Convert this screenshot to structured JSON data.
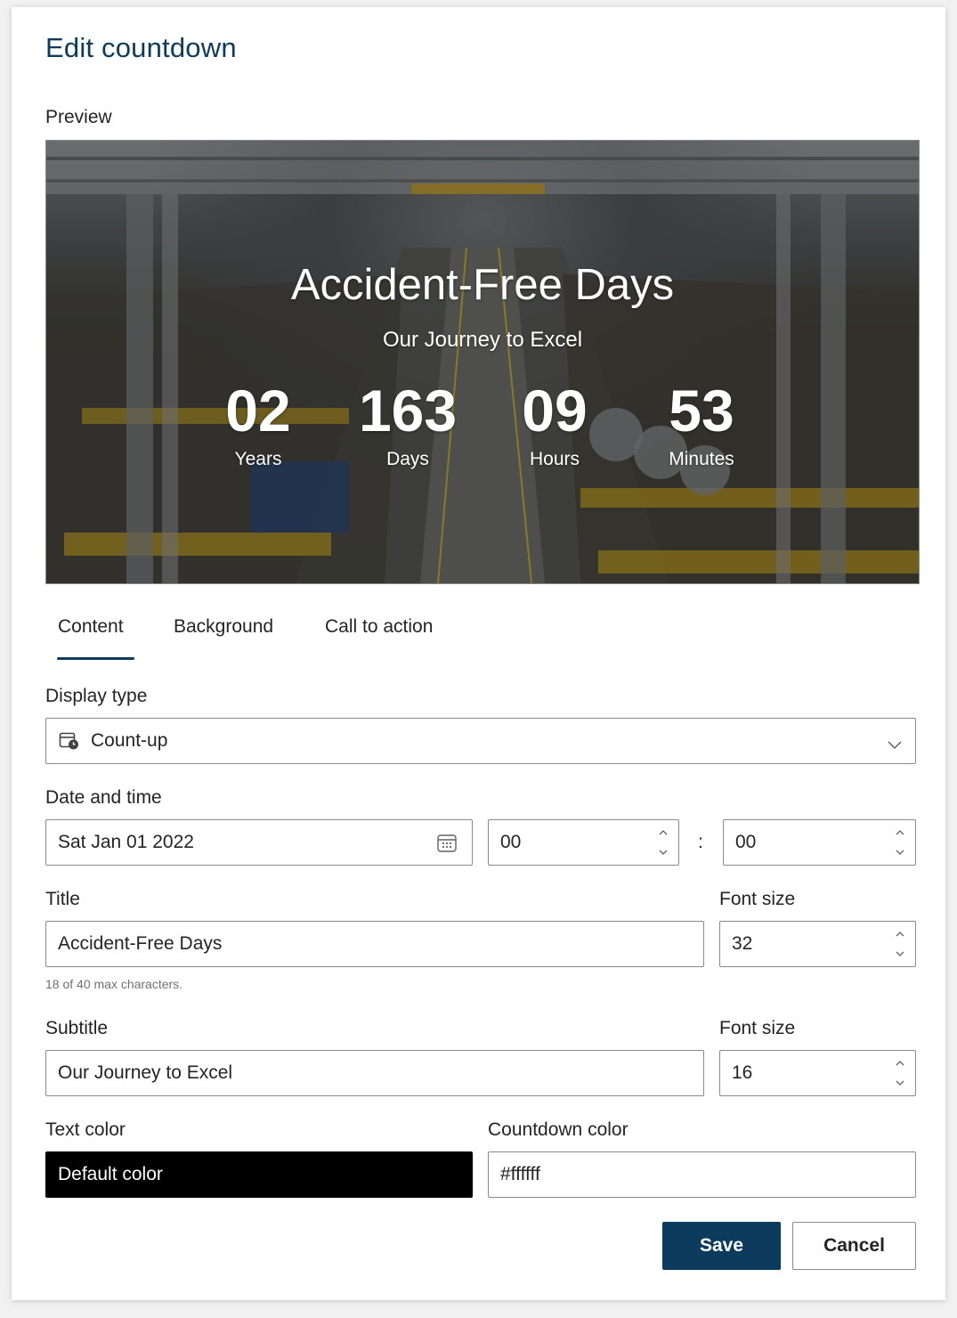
{
  "dialog": {
    "title": "Edit countdown"
  },
  "preview": {
    "label": "Preview",
    "title": "Accident-Free Days",
    "subtitle": "Our Journey to Excel",
    "units": [
      {
        "value": "02",
        "label": "Years"
      },
      {
        "value": "163",
        "label": "Days"
      },
      {
        "value": "09",
        "label": "Hours"
      },
      {
        "value": "53",
        "label": "Minutes"
      }
    ]
  },
  "tabs": [
    {
      "label": "Content",
      "selected": true
    },
    {
      "label": "Background",
      "selected": false
    },
    {
      "label": "Call to action",
      "selected": false
    }
  ],
  "form": {
    "display_type": {
      "label": "Display type",
      "value": "Count-up",
      "icon": "calendar-clock-icon"
    },
    "date_time": {
      "label": "Date and time",
      "date": "Sat Jan 01 2022",
      "hour": "00",
      "separator": ":",
      "minute": "00"
    },
    "title": {
      "label": "Title",
      "value": "Accident-Free Days",
      "help": "18 of 40 max characters.",
      "font_size_label": "Font size",
      "font_size": "32"
    },
    "subtitle": {
      "label": "Subtitle",
      "value": "Our Journey to Excel",
      "font_size_label": "Font size",
      "font_size": "16"
    },
    "text_color": {
      "label": "Text color",
      "value": "Default color",
      "swatch": "#000000"
    },
    "countdown_color": {
      "label": "Countdown color",
      "value": "#ffffff"
    }
  },
  "actions": {
    "save": "Save",
    "cancel": "Cancel"
  },
  "colors": {
    "accent": "#0c3b5e",
    "border": "#8a8a8a"
  }
}
